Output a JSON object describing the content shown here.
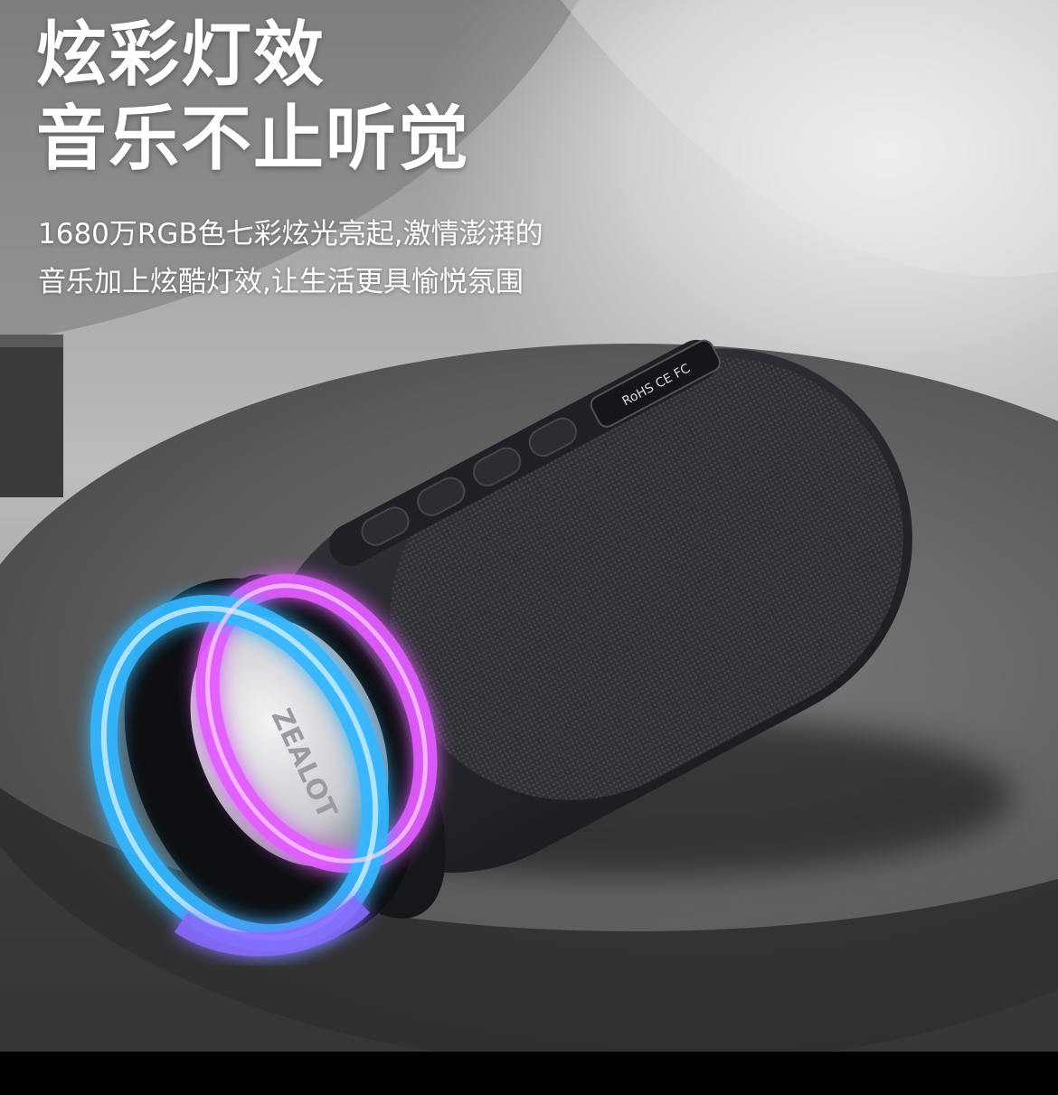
{
  "headline": {
    "line1": "炫彩灯效",
    "line2": "音乐不止听觉"
  },
  "description": {
    "line1": "1680万RGB色七彩炫光亮起,激情澎湃的",
    "line2": "音乐加上炫酷灯效,让生活更具愉悦氛围"
  },
  "product": {
    "brand_logo": "ZEALOT",
    "rating_plate": "RoHS  CE  FC",
    "colors": {
      "body": "#2a2c33",
      "ring_blue": "#36b6ff",
      "ring_pink": "#e25bff",
      "ring_purple": "#8b6bff"
    }
  }
}
